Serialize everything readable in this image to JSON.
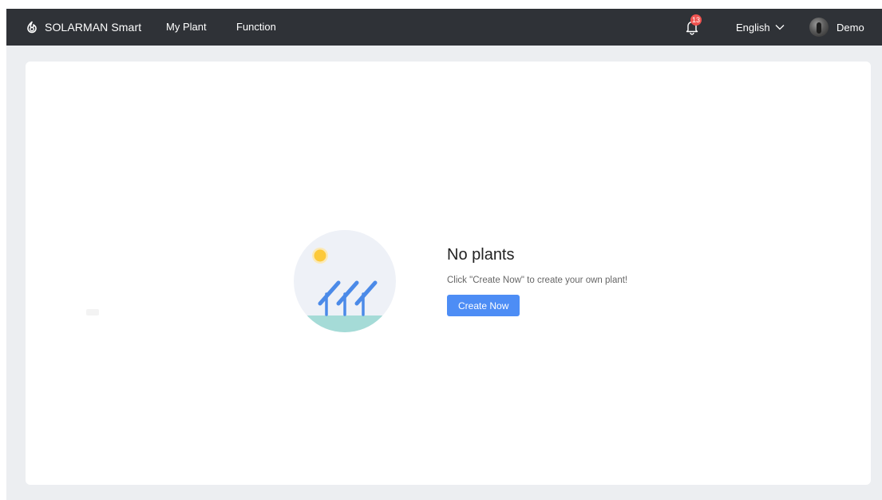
{
  "header": {
    "brand": "SOLARMAN Smart",
    "brand_icon": "solarman-logo-icon",
    "nav": [
      {
        "label": "My Plant"
      },
      {
        "label": "Function"
      }
    ],
    "notifications": {
      "icon": "bell-icon",
      "count": "13"
    },
    "language": {
      "label": "English",
      "icon": "chevron-down-icon"
    },
    "user": {
      "name": "Demo"
    }
  },
  "empty_state": {
    "title": "No plants",
    "description": "Click \"Create Now\" to create your own plant!",
    "button_label": "Create Now",
    "illustration": "solar-panels-illustration"
  },
  "colors": {
    "navbar": "#2f3237",
    "page_bg": "#eceef1",
    "primary": "#4d8df5",
    "badge": "#ef5350"
  }
}
